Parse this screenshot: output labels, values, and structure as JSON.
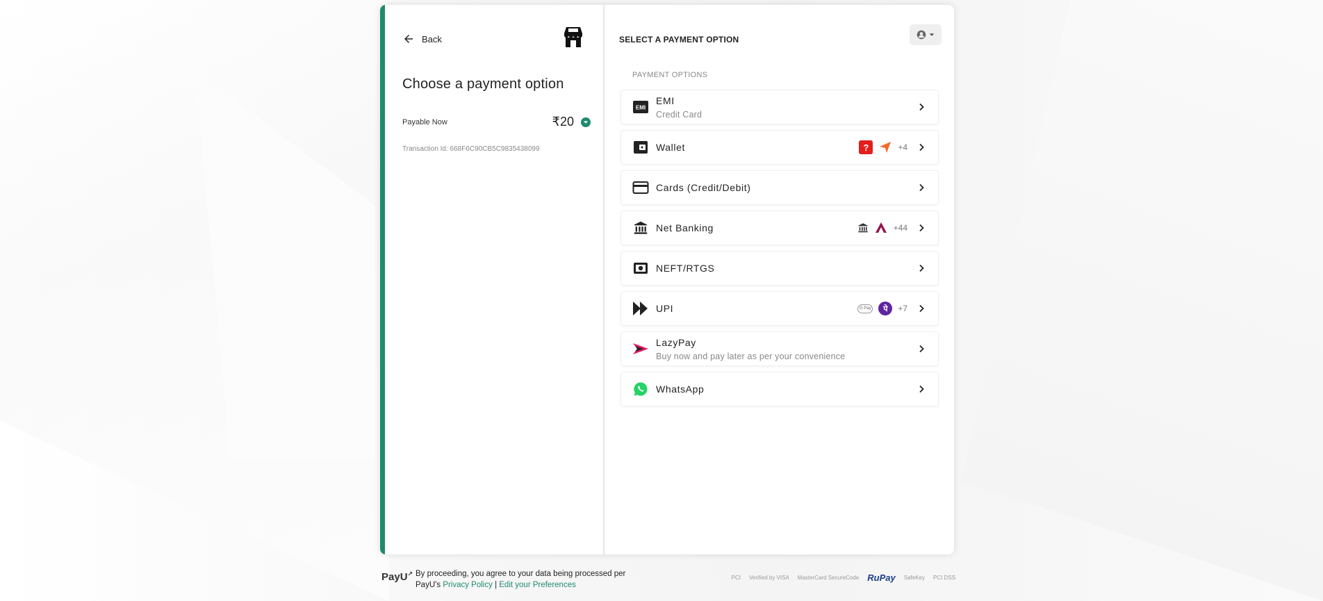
{
  "left": {
    "back_label": "Back",
    "title": "Choose a payment option",
    "payable_label": "Payable Now",
    "amount": "₹20",
    "transaction_id": "Transaction Id: 668F6C90CB5C9835438099"
  },
  "right": {
    "heading": "SELECT A PAYMENT OPTION",
    "section_title": "PAYMENT OPTIONS",
    "options": [
      {
        "name": "EMI",
        "sub": "Credit Card",
        "more": ""
      },
      {
        "name": "Wallet",
        "sub": "",
        "more": "+4"
      },
      {
        "name": "Cards (Credit/Debit)",
        "sub": "",
        "more": ""
      },
      {
        "name": "Net Banking",
        "sub": "",
        "more": "+44"
      },
      {
        "name": "NEFT/RTGS",
        "sub": "",
        "more": ""
      },
      {
        "name": "UPI",
        "sub": "",
        "more": "+7"
      },
      {
        "name": "LazyPay",
        "sub": "Buy now and pay later as per your convenience",
        "more": ""
      },
      {
        "name": "WhatsApp",
        "sub": "",
        "more": ""
      }
    ]
  },
  "footer": {
    "logo": "PayU",
    "consent_text": "By proceeding, you agree to your data being processed per PayU's",
    "privacy_link": "Privacy Policy",
    "separator": "|",
    "prefs_link": "Edit your Preferences",
    "badges": [
      "PCI",
      "Verified by VISA",
      "MasterCard SecureCode",
      "RuPay",
      "SafeKey",
      "PCI DSS"
    ]
  },
  "colors": {
    "accent": "#1f8a70",
    "text": "#222222",
    "muted": "#888888"
  }
}
